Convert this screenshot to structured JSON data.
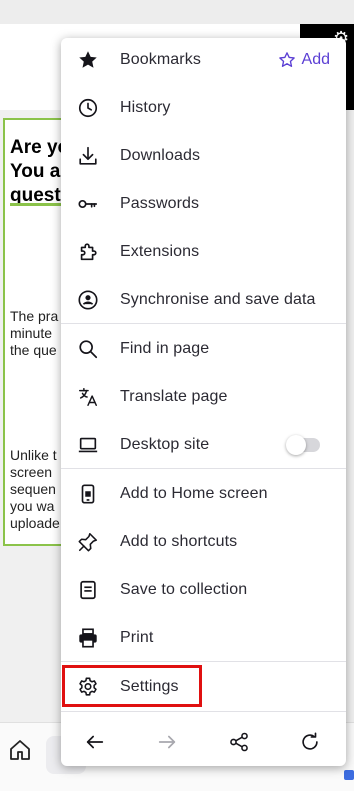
{
  "menu": {
    "items": [
      {
        "label": "Bookmarks",
        "icon": "star-filled-icon"
      },
      {
        "label": "History",
        "icon": "clock-icon"
      },
      {
        "label": "Downloads",
        "icon": "download-icon"
      },
      {
        "label": "Passwords",
        "icon": "key-icon"
      },
      {
        "label": "Extensions",
        "icon": "puzzle-icon"
      },
      {
        "label": "Synchronise and save data",
        "icon": "account-icon"
      },
      {
        "label": "Find in page",
        "icon": "search-icon"
      },
      {
        "label": "Translate page",
        "icon": "translate-icon"
      },
      {
        "label": "Desktop site",
        "icon": "laptop-icon"
      },
      {
        "label": "Add to Home screen",
        "icon": "add-to-home-icon"
      },
      {
        "label": "Add to shortcuts",
        "icon": "pin-icon"
      },
      {
        "label": "Save to collection",
        "icon": "collection-icon"
      },
      {
        "label": "Print",
        "icon": "printer-icon"
      },
      {
        "label": "Settings",
        "icon": "gear-icon"
      }
    ],
    "add_label": "Add",
    "desktop_site_enabled": false
  },
  "background": {
    "heading_lines": [
      "Are yo",
      "You a",
      "quest"
    ],
    "para1": [
      "The pra",
      "minute",
      "the que"
    ],
    "para2": [
      "Unlike t",
      "screen",
      "sequen",
      "you wa",
      "uploade"
    ]
  },
  "colors": {
    "accent": "#5b3fd4",
    "highlight": "#e01010",
    "card_border": "#8bc34a"
  }
}
